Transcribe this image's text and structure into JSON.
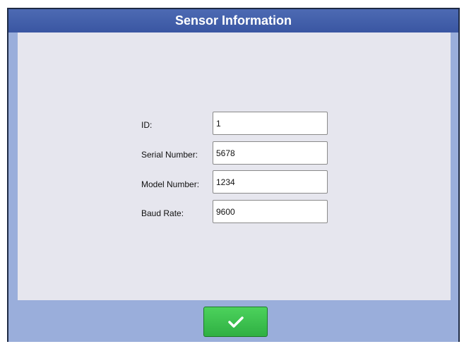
{
  "dialog": {
    "title": "Sensor Information"
  },
  "fields": [
    {
      "label": "ID:",
      "value": "1"
    },
    {
      "label": "Serial Number:",
      "value": "5678"
    },
    {
      "label": "Model Number:",
      "value": "1234"
    },
    {
      "label": "Baud Rate:",
      "value": "9600"
    }
  ],
  "footer": {
    "confirm_icon": "checkmark-icon"
  },
  "colors": {
    "title_bar": "#3f5aa6",
    "dialog_frame": "#9aaedb",
    "content_panel": "#e6e6ee",
    "confirm_button": "#3cbf4f"
  }
}
